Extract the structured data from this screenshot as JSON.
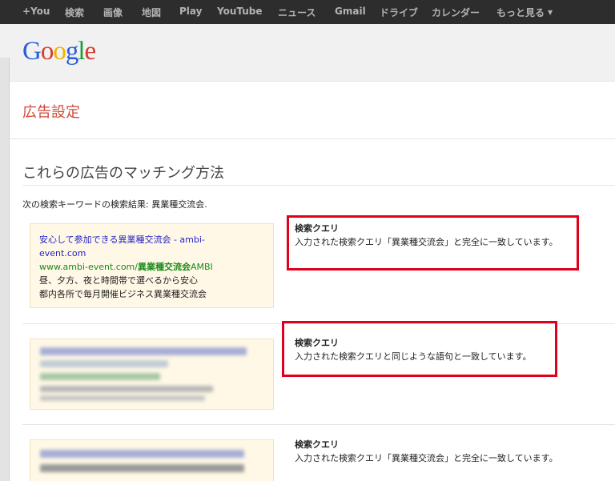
{
  "topnav": {
    "items": [
      {
        "label": "+You"
      },
      {
        "label": "検索"
      },
      {
        "label": "画像"
      },
      {
        "label": "地図"
      },
      {
        "label": "Play"
      },
      {
        "label": "YouTube"
      },
      {
        "label": "ニュース"
      },
      {
        "label": "Gmail"
      },
      {
        "label": "ドライブ"
      },
      {
        "label": "カレンダー"
      },
      {
        "label": "もっと見る"
      }
    ]
  },
  "logo": {
    "text": "Google",
    "letters": [
      "G",
      "o",
      "o",
      "g",
      "l",
      "e"
    ]
  },
  "page_title": "広告設定",
  "section": {
    "title": "これらの広告のマッチング方法",
    "description": "次の検索キーワードの検索結果: 異業種交流会."
  },
  "ads": [
    {
      "title": "安心して参加できる異業種交流会 - ambi-event.com",
      "url_plain": "www.ambi-event.com/",
      "url_highlight": "異業種交流会",
      "url_suffix": "AMBI",
      "line1": "昼、夕方、夜と時間帯で選べるから安心",
      "line2": "都内各所で毎月開催ビジネス異業種交流会"
    }
  ],
  "matches": [
    {
      "type": "検索クエリ",
      "detail": "入力された検索クエリ「異業種交流会」と完全に一致しています。"
    },
    {
      "type": "検索クエリ",
      "detail": "入力された検索クエリと同じような語句と一致しています。"
    },
    {
      "type": "検索クエリ",
      "detail": "入力された検索クエリ「異業種交流会」と完全に一致しています。"
    }
  ],
  "colors": {
    "topbar": "#2d2d2d",
    "page_title": "#d14836",
    "highlight_box": "#e0001c",
    "ad_background": "#fff8e6",
    "ad_title": "#2323c8",
    "ad_url": "#1a8a1a"
  }
}
